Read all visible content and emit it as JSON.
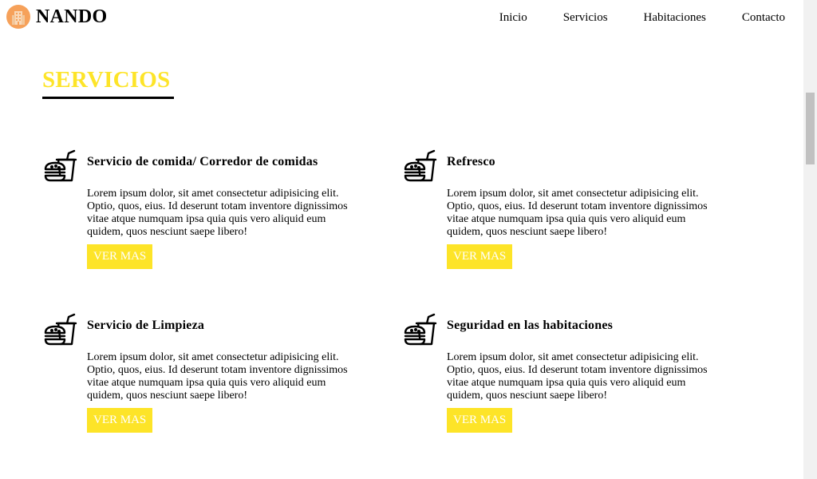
{
  "header": {
    "brand": "NANDO",
    "nav": [
      "Inicio",
      "Servicios",
      "Habitaciones",
      "Contacto"
    ]
  },
  "section": {
    "title": "SERVICIOS"
  },
  "services": [
    {
      "title": "Servicio de comida/ Corredor de comidas",
      "text": "Lorem ipsum dolor, sit amet consectetur adipisicing elit. Optio, quos, eius. Id deserunt totam inventore dignissimos vitae atque numquam ipsa quia quis vero aliquid eum quidem, quos nesciunt saepe libero!",
      "button": "VER MAS",
      "icon": "fast-food-icon"
    },
    {
      "title": "Refresco",
      "text": "Lorem ipsum dolor, sit amet consectetur adipisicing elit. Optio, quos, eius. Id deserunt totam inventore dignissimos vitae atque numquam ipsa quia quis vero aliquid eum quidem, quos nesciunt saepe libero!",
      "button": "VER MAS",
      "icon": "fast-food-icon"
    },
    {
      "title": "Servicio de Limpieza",
      "text": "Lorem ipsum dolor, sit amet consectetur adipisicing elit. Optio, quos, eius. Id deserunt totam inventore dignissimos vitae atque numquam ipsa quia quis vero aliquid eum quidem, quos nesciunt saepe libero!",
      "button": "VER MAS",
      "icon": "fast-food-icon"
    },
    {
      "title": "Seguridad en las habitaciones",
      "text": "Lorem ipsum dolor, sit amet consectetur adipisicing elit. Optio, quos, eius. Id deserunt totam inventore dignissimos vitae atque numquam ipsa quia quis vero aliquid eum quidem, quos nesciunt saepe libero!",
      "button": "VER MAS",
      "icon": "fast-food-icon"
    }
  ],
  "colors": {
    "accent": "#fde428",
    "logo_bg": "#f6a15a",
    "text": "#000000"
  }
}
